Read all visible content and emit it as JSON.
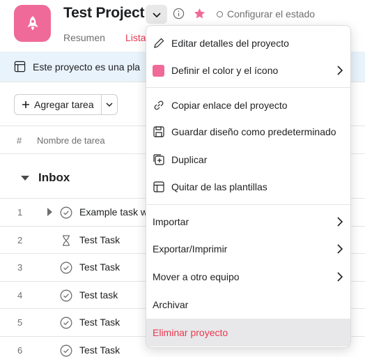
{
  "header": {
    "project_title": "Test Project",
    "status_label": "Configurar el estado",
    "accent_color": "#e8384f",
    "project_color": "#f06a99"
  },
  "tabs": [
    {
      "label": "Resumen"
    },
    {
      "label": "Lista"
    }
  ],
  "banner": {
    "text": "Este proyecto es una pla"
  },
  "toolbar": {
    "add_task_label": "Agregar tarea"
  },
  "table": {
    "columns": [
      "#",
      "Nombre de tarea"
    ],
    "section_title": "Inbox",
    "rows": [
      {
        "num": "1",
        "name": "Example task w",
        "icon": "check-circle-icon"
      },
      {
        "num": "2",
        "name": "Test Task",
        "icon": "hourglass-icon"
      },
      {
        "num": "3",
        "name": "Test Task",
        "icon": "check-circle-icon"
      },
      {
        "num": "4",
        "name": "Test task",
        "icon": "check-circle-icon"
      },
      {
        "num": "5",
        "name": "Test Task",
        "icon": "check-circle-icon"
      },
      {
        "num": "6",
        "name": "Test Task",
        "icon": "check-circle-icon"
      }
    ]
  },
  "menu": {
    "items": [
      {
        "label": "Editar detalles del proyecto",
        "icon": "pencil-icon"
      },
      {
        "label": "Definir el color y el ícono",
        "icon": "color-swatch-icon"
      },
      {
        "label": "Copiar enlace del proyecto",
        "icon": "link-icon"
      },
      {
        "label": "Guardar diseño como predeterminado",
        "icon": "save-layout-icon"
      },
      {
        "label": "Duplicar",
        "icon": "duplicate-icon"
      },
      {
        "label": "Quitar de las plantillas",
        "icon": "template-icon"
      },
      {
        "label": "Importar"
      },
      {
        "label": "Exportar/Imprimir"
      },
      {
        "label": "Mover a otro equipo"
      },
      {
        "label": "Archivar"
      },
      {
        "label": "Eliminar proyecto"
      }
    ]
  }
}
